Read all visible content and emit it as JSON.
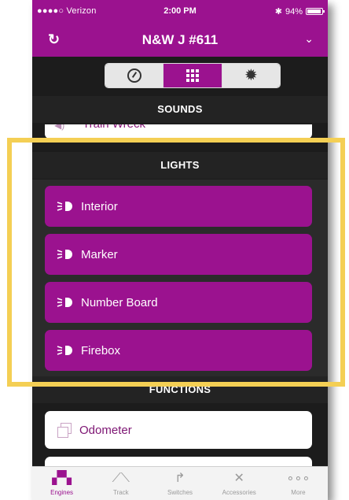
{
  "status_bar": {
    "carrier": "●●●●○ Verizon",
    "time": "2:00 PM",
    "battery": "94%"
  },
  "nav": {
    "title": "N&W J #611"
  },
  "segments": [
    "gauge-icon",
    "grid-icon",
    "gear-icon"
  ],
  "sounds": {
    "header": "SOUNDS",
    "partial_item": "Train Wreck"
  },
  "lights": {
    "header": "LIGHTS",
    "items": [
      {
        "label": "Interior"
      },
      {
        "label": "Marker"
      },
      {
        "label": "Number Board"
      },
      {
        "label": "Firebox"
      }
    ]
  },
  "functions": {
    "header": "FUNCTIONS",
    "items": [
      {
        "label": "Odometer"
      }
    ]
  },
  "tabs": [
    {
      "label": "Engines",
      "icon": "engine-icon"
    },
    {
      "label": "Track",
      "icon": "track-icon"
    },
    {
      "label": "Switches",
      "icon": "switch-icon"
    },
    {
      "label": "Accessories",
      "icon": "accessory-icon"
    },
    {
      "label": "More",
      "icon": "more-icon"
    }
  ],
  "colors": {
    "accent": "#9b128f",
    "highlight": "#f4cf54",
    "background": "#1c1c1c"
  }
}
